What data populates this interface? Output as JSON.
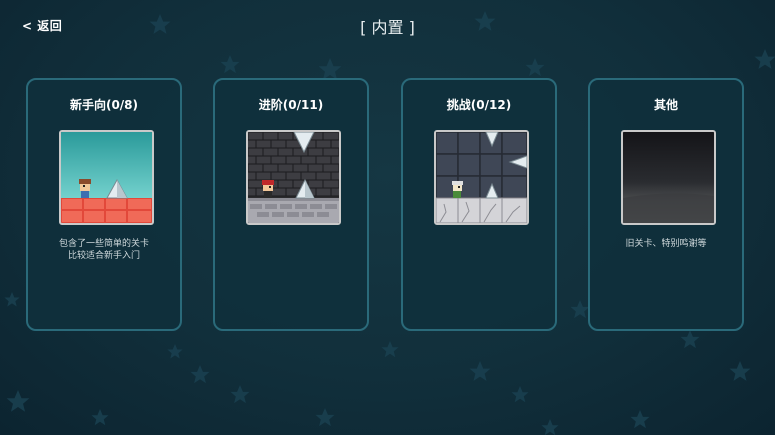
{
  "header": {
    "back_label": "< 返回",
    "title": "[ 内置 ]"
  },
  "categories": [
    {
      "title": "新手向(0/8)",
      "desc_line1": "包含了一些简单的关卡",
      "desc_line2": "比较适合新手入门"
    },
    {
      "title": "进阶(0/11)",
      "desc_line1": "",
      "desc_line2": ""
    },
    {
      "title": "挑战(0/12)",
      "desc_line1": "",
      "desc_line2": ""
    },
    {
      "title": "其他",
      "desc_line1": "旧关卡、特别鸣谢等",
      "desc_line2": ""
    }
  ],
  "colors": {
    "background": "#112f3b",
    "card_border": "#2a6a7a",
    "card_fill": "#0f303c"
  }
}
